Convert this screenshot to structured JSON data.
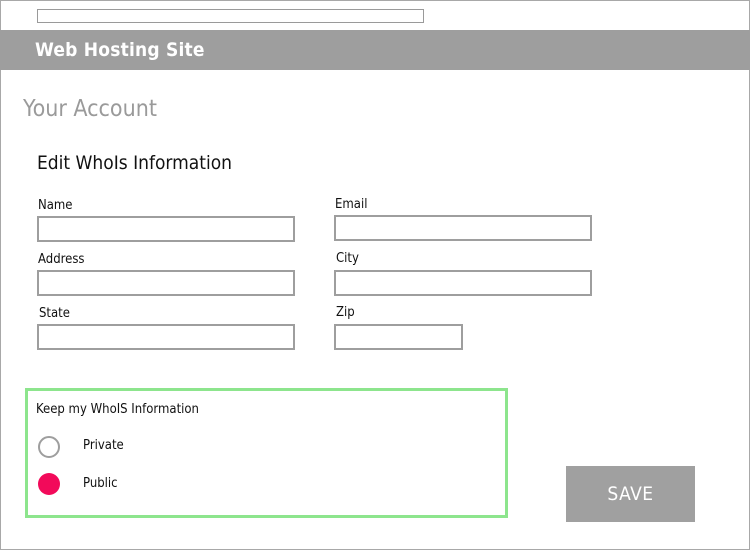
{
  "header": {
    "site_title": "Web Hosting Site"
  },
  "page": {
    "title": "Your Account",
    "section_title": "Edit WhoIs Information"
  },
  "form": {
    "name_label": "Name",
    "name_value": "",
    "email_label": "Email",
    "email_value": "",
    "address_label": "Address",
    "address_value": "",
    "city_label": "City",
    "city_value": "",
    "state_label": "State",
    "state_value": "",
    "zip_label": "Zip",
    "zip_value": ""
  },
  "privacy": {
    "heading": "Keep my WhoIS Information",
    "options": [
      {
        "label": "Private",
        "selected": false
      },
      {
        "label": "Public",
        "selected": true
      }
    ],
    "selected_color": "#f20a5a",
    "border_color": "#8de58d"
  },
  "actions": {
    "save_label": "SAVE"
  },
  "colors": {
    "header_bg": "#9e9e9e",
    "button_bg": "#a0a0a0",
    "input_border": "#9e9e9e"
  }
}
